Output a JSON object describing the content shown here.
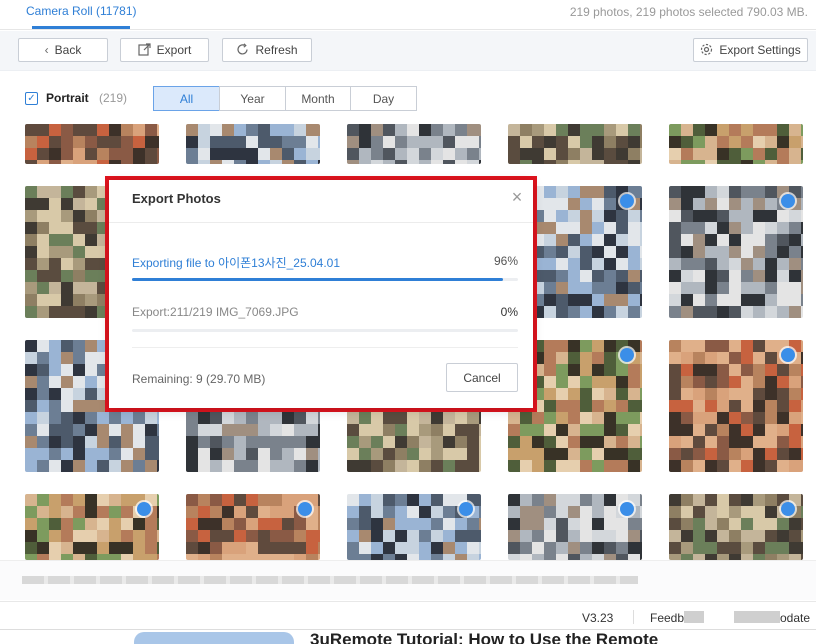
{
  "topbar": {
    "tab": "Camera Roll (11781)",
    "summary": "219 photos, 219 photos selected 790.03 MB."
  },
  "toolbar": {
    "back": "Back",
    "export": "Export",
    "refresh": "Refresh",
    "export_settings": "Export Settings"
  },
  "filter": {
    "album": "Portrait",
    "count": "(219)",
    "checked": true,
    "segments": [
      "All",
      "Year",
      "Month",
      "Day"
    ],
    "active_segment": "All"
  },
  "dialog": {
    "title": "Export Photos",
    "file_progress_label": "Exporting file to",
    "destination": "아이폰13사진_25.04.01",
    "file_progress_pct": "96%",
    "file_progress_value": 0.96,
    "item_progress_label": "Export:211/219 IMG_7069.JPG",
    "item_progress_pct": "0%",
    "item_progress_value": 0,
    "remaining": "Remaining: 9 (29.70 MB)",
    "cancel": "Cancel"
  },
  "statusbar": {
    "version": "V3.23",
    "feedback": "Feedb",
    "update": "odate"
  },
  "background": {
    "article_title": "3uRemote Tutorial: How to Use the Remote"
  },
  "colors": {
    "accent": "#2f7fd6",
    "highlight_border": "#e0141e",
    "toolbar_bg": "#f4f6f9"
  }
}
